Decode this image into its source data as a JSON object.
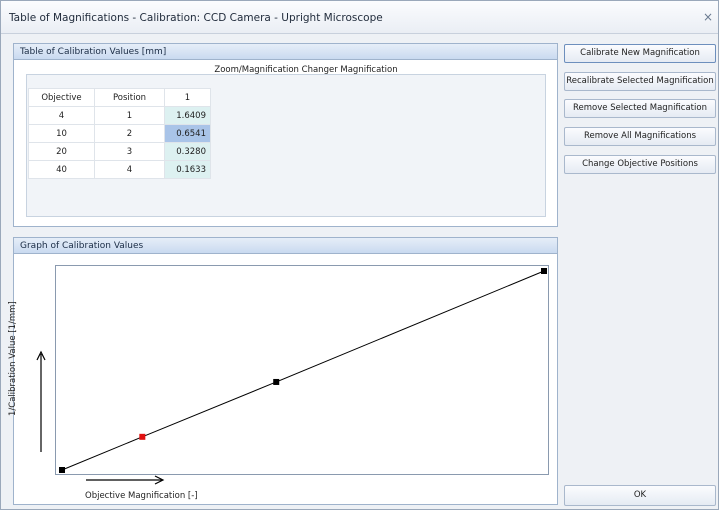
{
  "window": {
    "title": "Table of Magnifications - Calibration: CCD Camera - Upright Microscope",
    "close_glyph": "×"
  },
  "table_panel": {
    "title": "Table of Calibration Values [mm]",
    "group_caption": "Zoom/Magnification Changer Magnification",
    "headers": {
      "objective": "Objective",
      "position": "Position",
      "value": "1"
    },
    "rows": [
      {
        "objective": "4",
        "position": "1",
        "value": "1.6409"
      },
      {
        "objective": "10",
        "position": "2",
        "value": "0.6541"
      },
      {
        "objective": "20",
        "position": "3",
        "value": "0.3280"
      },
      {
        "objective": "40",
        "position": "4",
        "value": "0.1633"
      }
    ],
    "selected_row": 1
  },
  "graph_panel": {
    "title": "Graph of Calibration Values",
    "y_label": "1/Calibration Value [1/mm]",
    "x_label": "Objective Magnification [-]"
  },
  "chart_data": {
    "type": "line",
    "x": [
      4,
      10,
      20,
      40
    ],
    "y": [
      0.6094,
      1.5288,
      3.0488,
      6.1237
    ],
    "highlight_index": 1,
    "highlight_color": "#e01010",
    "point_color": "#000000",
    "line_color": "#000000",
    "xlim": [
      4,
      40
    ],
    "ylim": [
      0.6094,
      6.1237
    ],
    "grid": false
  },
  "buttons": {
    "calibrate_new": "Calibrate New Magnification",
    "recalibrate_selected": "Recalibrate Selected Magnification",
    "remove_selected": "Remove Selected Magnification",
    "remove_all": "Remove All Magnifications",
    "change_positions": "Change Objective Positions",
    "ok": "OK"
  },
  "colors": {
    "value_cell": "#ddf1f1",
    "selected_cell": "#a9c4e8",
    "panel_header": "#c9daf0"
  }
}
